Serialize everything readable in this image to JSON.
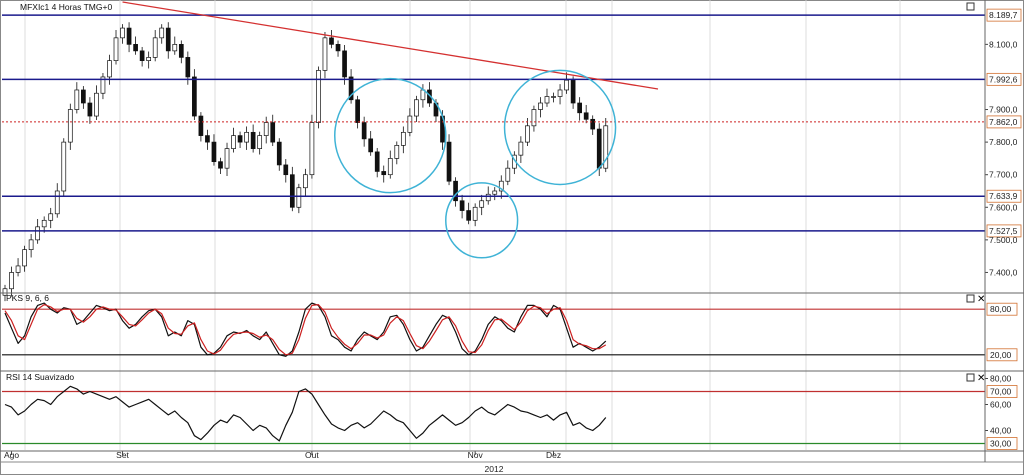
{
  "chart_data": [
    {
      "panel": "price",
      "type": "candlestick",
      "title": "MFXIc1 4 Horas TMG+0",
      "ylim": [
        7340,
        8230
      ],
      "y_ticks": [
        "8.100,0",
        "7.900,0",
        "7.800,0",
        "7.700,0",
        "7.600,0",
        "7.500,0",
        "7.400,0"
      ],
      "y_tick_values": [
        8100,
        7900,
        7800,
        7700,
        7600,
        7500,
        7400
      ],
      "horizontal_levels": [
        {
          "value": 8189.7,
          "label": "8.189,7",
          "color": "#1a1a8c",
          "style": "solid"
        },
        {
          "value": 7992.6,
          "label": "7.992,6",
          "color": "#1a1a8c",
          "style": "solid"
        },
        {
          "value": 7862.0,
          "label": "7.862,0",
          "color": "#cc2222",
          "style": "dotted"
        },
        {
          "value": 7633.9,
          "label": "7.633,9",
          "color": "#1a1a8c",
          "style": "solid"
        },
        {
          "value": 7527.5,
          "label": "7.527,5",
          "color": "#1a1a8c",
          "style": "solid"
        }
      ],
      "trendline": {
        "from": {
          "bar": 18,
          "value": 8230
        },
        "to": {
          "bar": 100,
          "value": 7963
        },
        "color": "#d43030"
      },
      "circles": [
        {
          "center_bar": 59,
          "center_value": 7820,
          "radius_bars": 8.5,
          "radius_value": 175,
          "color": "#3fb3d6"
        },
        {
          "center_bar": 73,
          "center_value": 7560,
          "radius_bars": 5.5,
          "radius_value": 115,
          "color": "#3fb3d6"
        },
        {
          "center_bar": 85,
          "center_value": 7845,
          "radius_bars": 8.5,
          "radius_value": 175,
          "color": "#3fb3d6"
        }
      ],
      "x_labels": [
        "Ago",
        "Set",
        "Out",
        "Nov",
        "Dez"
      ],
      "x_label_bars": [
        1,
        18,
        47,
        72,
        84
      ],
      "year_label": "2012",
      "close": [
        7350,
        7400,
        7420,
        7470,
        7500,
        7540,
        7560,
        7580,
        7650,
        7800,
        7900,
        7960,
        7920,
        7880,
        7950,
        8000,
        8050,
        8120,
        8150,
        8100,
        8080,
        8050,
        8060,
        8120,
        8150,
        8080,
        8100,
        8060,
        8000,
        7880,
        7820,
        7800,
        7740,
        7720,
        7780,
        7820,
        7800,
        7830,
        7780,
        7820,
        7860,
        7800,
        7730,
        7700,
        7600,
        7660,
        7700,
        7860,
        8020,
        8120,
        8100,
        8080,
        8000,
        7930,
        7860,
        7810,
        7770,
        7710,
        7700,
        7750,
        7790,
        7830,
        7880,
        7930,
        7960,
        7920,
        7880,
        7800,
        7680,
        7620,
        7590,
        7560,
        7600,
        7620,
        7640,
        7650,
        7680,
        7720,
        7760,
        7800,
        7850,
        7900,
        7920,
        7940,
        7940,
        7960,
        7990,
        7920,
        7890,
        7870,
        7840,
        7720,
        7850
      ]
    },
    {
      "panel": "stochastic",
      "type": "line",
      "title": "PKS 9, 6, 6",
      "ylim": [
        0,
        100
      ],
      "levels": [
        {
          "value": 80,
          "label": "80,00",
          "color": "#c03030"
        },
        {
          "value": 20,
          "label": "20,00",
          "color": "#111111"
        }
      ],
      "series": [
        {
          "color": "#111111",
          "values": [
            75,
            55,
            35,
            45,
            70,
            85,
            88,
            80,
            75,
            82,
            80,
            60,
            65,
            75,
            85,
            82,
            78,
            80,
            65,
            55,
            60,
            70,
            78,
            80,
            70,
            45,
            50,
            45,
            65,
            60,
            30,
            20,
            22,
            30,
            45,
            50,
            48,
            52,
            45,
            40,
            50,
            35,
            20,
            18,
            25,
            50,
            80,
            88,
            85,
            70,
            45,
            40,
            30,
            25,
            40,
            50,
            45,
            40,
            50,
            70,
            72,
            60,
            40,
            25,
            30,
            45,
            60,
            72,
            68,
            50,
            28,
            20,
            25,
            40,
            60,
            70,
            65,
            55,
            50,
            70,
            85,
            85,
            80,
            70,
            85,
            80,
            55,
            30,
            35,
            30,
            25,
            30,
            38
          ]
        },
        {
          "color": "#cc2020",
          "values": [
            78,
            65,
            45,
            40,
            60,
            80,
            86,
            83,
            77,
            80,
            80,
            68,
            63,
            70,
            80,
            83,
            80,
            79,
            70,
            60,
            58,
            66,
            75,
            80,
            74,
            55,
            48,
            47,
            58,
            62,
            40,
            25,
            21,
            26,
            38,
            47,
            49,
            50,
            48,
            43,
            46,
            40,
            27,
            20,
            22,
            40,
            68,
            85,
            86,
            76,
            55,
            43,
            34,
            28,
            35,
            46,
            46,
            42,
            46,
            62,
            70,
            65,
            48,
            32,
            28,
            38,
            52,
            66,
            70,
            58,
            38,
            24,
            23,
            33,
            52,
            66,
            67,
            60,
            53,
            63,
            78,
            84,
            82,
            74,
            80,
            82,
            65,
            40,
            34,
            32,
            28,
            28,
            33
          ]
        }
      ]
    },
    {
      "panel": "rsi",
      "type": "line",
      "title": "RSI 14 Suavizado",
      "ylim": [
        25,
        85
      ],
      "y_ticks": [
        "80,00",
        "60,00",
        "40,00"
      ],
      "y_tick_values": [
        80,
        60,
        40
      ],
      "levels": [
        {
          "value": 70,
          "label": "70,00",
          "color": "#c03030"
        },
        {
          "value": 30,
          "label": "30,00",
          "color": "#2a8a2a"
        }
      ],
      "series": [
        {
          "color": "#111111",
          "values": [
            60,
            58,
            52,
            55,
            60,
            64,
            63,
            60,
            66,
            70,
            74,
            72,
            68,
            70,
            68,
            66,
            64,
            66,
            62,
            58,
            60,
            62,
            64,
            60,
            56,
            52,
            55,
            50,
            46,
            36,
            33,
            38,
            44,
            48,
            46,
            52,
            50,
            45,
            40,
            44,
            42,
            36,
            32,
            44,
            54,
            70,
            72,
            68,
            60,
            52,
            45,
            42,
            40,
            44,
            46,
            42,
            45,
            50,
            55,
            52,
            48,
            46,
            40,
            34,
            38,
            44,
            48,
            52,
            48,
            44,
            46,
            50,
            55,
            58,
            54,
            52,
            56,
            60,
            58,
            55,
            54,
            52,
            50,
            52,
            48,
            52,
            54,
            44,
            46,
            42,
            40,
            44,
            50
          ]
        }
      ]
    }
  ],
  "ui": {
    "panel2_title": "PKS 9, 6, 6",
    "panel3_title": "RSI 14 Suavizado"
  }
}
